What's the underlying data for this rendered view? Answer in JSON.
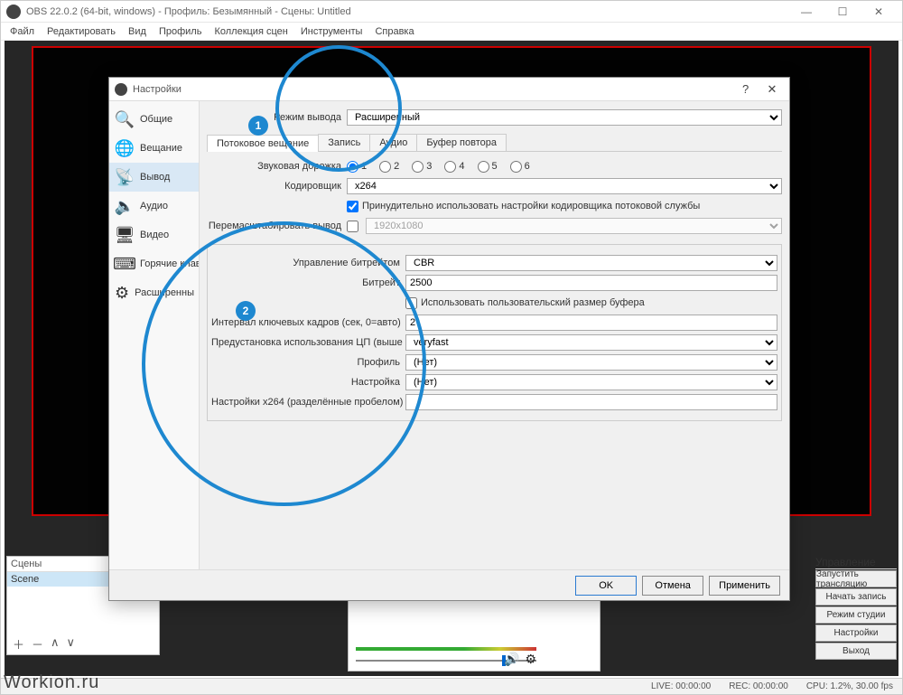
{
  "main_window": {
    "title": "OBS 22.0.2 (64-bit, windows) - Профиль: Безымянный - Сцены: Untitled",
    "menu": [
      "Файл",
      "Редактировать",
      "Вид",
      "Профиль",
      "Коллекция сцен",
      "Инструменты",
      "Справка"
    ]
  },
  "panels": {
    "scenes_title": "Сцены",
    "scene_item": "Scene",
    "controls_title": "Управление",
    "buttons": {
      "start_stream": "Запустить трансляцию",
      "start_rec": "Начать запись",
      "studio": "Режим студии",
      "settings": "Настройки",
      "exit": "Выход"
    }
  },
  "statusbar": {
    "live": "LIVE: 00:00:00",
    "rec": "REC: 00:00:00",
    "cpu": "CPU: 1.2%, 30.00 fps"
  },
  "dialog": {
    "title": "Настройки",
    "sidebar": [
      "Общие",
      "Вещание",
      "Вывод",
      "Аудио",
      "Видео",
      "Горячие клав",
      "Расширенны"
    ],
    "output_mode_label": "Режим вывода",
    "output_mode_value": "Расширенный",
    "tabs": [
      "Потоковое вещание",
      "Запись",
      "Аудио",
      "Буфер повтора"
    ],
    "audio_track_label": "Звуковая дорожка",
    "encoder_label": "Кодировщик",
    "encoder_value": "x264",
    "enforce_label": "Принудительно использовать настройки кодировщика потоковой службы",
    "rescale_label": "Перемасштабировать вывод",
    "rescale_value": "1920x1080",
    "rate_control_label": "Управление битрейтом",
    "rate_control_value": "CBR",
    "bitrate_label": "Битрейт",
    "bitrate_value": "2500",
    "custom_buffer_label": "Использовать пользовательский размер буфера",
    "keyint_label": "Интервал ключевых кадров (сек, 0=авто)",
    "keyint_value": "2",
    "cpu_preset_label": "Предустановка использования ЦП (выше = меньше)",
    "cpu_preset_value": "veryfast",
    "profile_label": "Профиль",
    "profile_value": "(Нет)",
    "tune_label": "Настройка",
    "tune_value": "(Нет)",
    "x264opts_label": "Настройки x264 (разделённые пробелом)",
    "buttons": {
      "ok": "OK",
      "cancel": "Отмена",
      "apply": "Применить"
    }
  },
  "badges": {
    "one": "1",
    "two": "2"
  },
  "watermark": "Workion.ru"
}
